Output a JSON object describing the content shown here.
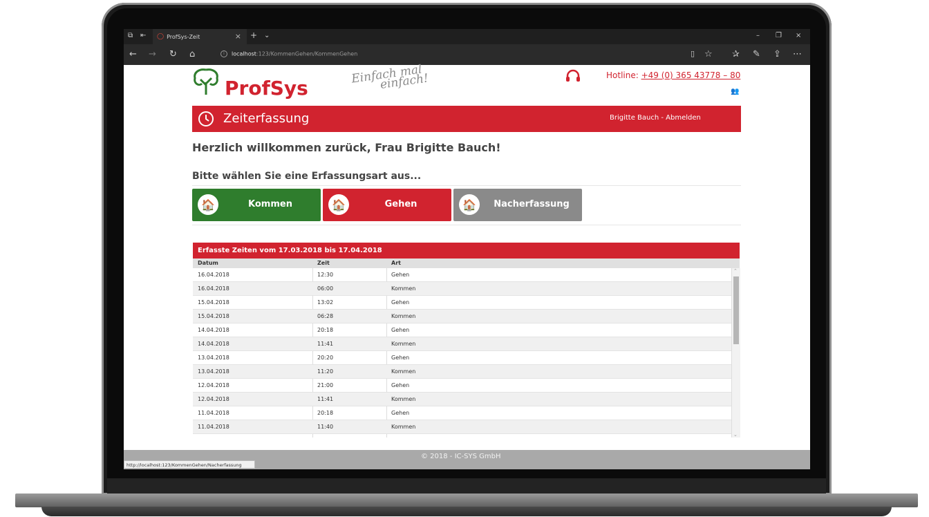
{
  "browser": {
    "tab_title": "ProfSys-Zeit",
    "url_host": "localhost",
    "url_rest": ":123/KommenGehen/KommenGehen",
    "status_url": "http://localhost:123/KommenGehen/Nacherfassung"
  },
  "header": {
    "brand": "ProfSys",
    "slogan_line1": "Einfach mal",
    "slogan_line2": "einfach!",
    "hotline_label": "Hotline: ",
    "hotline_number": "+49 (0) 365 43778 – 80"
  },
  "titlebar": {
    "title": "Zeiterfassung",
    "user_logout": "Brigitte Bauch - Abmelden"
  },
  "main": {
    "welcome": "Herzlich willkommen zurück, Frau Brigitte Bauch!",
    "choose": "Bitte wählen Sie eine Erfassungsart aus...",
    "buttons": {
      "kommen": "Kommen",
      "gehen": "Gehen",
      "nacherfassung": "Nacherfassung"
    }
  },
  "table": {
    "title": "Erfasste Zeiten vom 17.03.2018 bis 17.04.2018",
    "columns": [
      "Datum",
      "Zeit",
      "Art"
    ],
    "rows": [
      [
        "16.04.2018",
        "12:30",
        "Gehen"
      ],
      [
        "16.04.2018",
        "06:00",
        "Kommen"
      ],
      [
        "15.04.2018",
        "13:02",
        "Gehen"
      ],
      [
        "15.04.2018",
        "06:28",
        "Kommen"
      ],
      [
        "14.04.2018",
        "20:18",
        "Gehen"
      ],
      [
        "14.04.2018",
        "11:41",
        "Kommen"
      ],
      [
        "13.04.2018",
        "20:20",
        "Gehen"
      ],
      [
        "13.04.2018",
        "11:20",
        "Kommen"
      ],
      [
        "12.04.2018",
        "21:00",
        "Gehen"
      ],
      [
        "12.04.2018",
        "11:41",
        "Kommen"
      ],
      [
        "11.04.2018",
        "20:18",
        "Gehen"
      ],
      [
        "11.04.2018",
        "11:40",
        "Kommen"
      ]
    ]
  },
  "footer": {
    "copyright": "© 2018 - IC-SYS GmbH"
  },
  "colors": {
    "brand_red": "#d1232f",
    "kommen_green": "#2f7d2d",
    "nacherfassung_grey": "#8a8a8a"
  }
}
